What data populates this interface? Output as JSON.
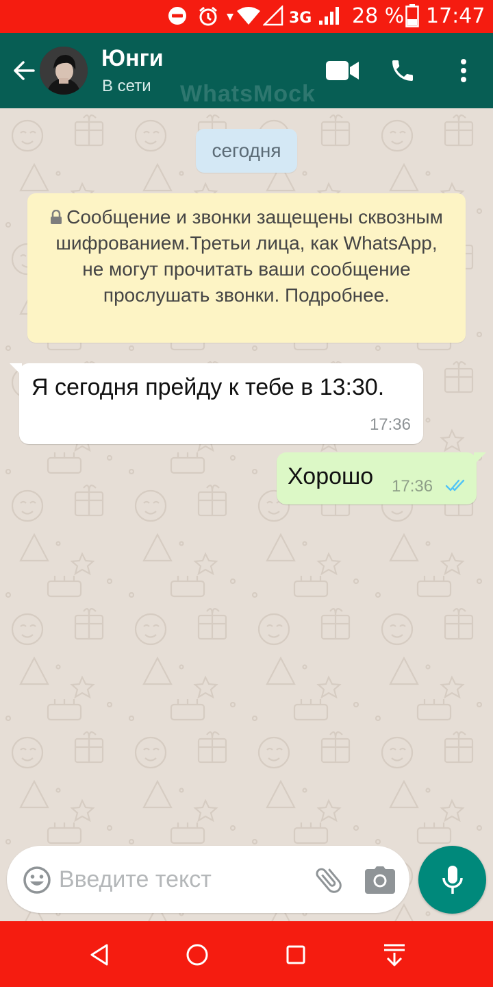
{
  "status_bar": {
    "network": "3G",
    "battery": "28 %",
    "time": "17:47"
  },
  "header": {
    "contact_name": "Юнги",
    "contact_status": "В сети",
    "watermark": "WhatsMock",
    "icons": [
      "back-arrow-icon",
      "video-call-icon",
      "phone-icon",
      "more-vert-icon"
    ]
  },
  "chat": {
    "date_chip": "сегодня",
    "encryption_notice": "Сообщение и звонки защещены сквозным шифрованием.Третьи лица, как WhatsApp, не могут прочитать ваши сообщение прослушать звонки. Подробнее.",
    "messages": [
      {
        "direction": "incoming",
        "text": "Я сегодня прейду к тебе в 13:30.",
        "time": "17:36"
      },
      {
        "direction": "outgoing",
        "text": "Хорошо",
        "time": "17:36",
        "status": "read"
      }
    ]
  },
  "composer": {
    "placeholder": "Введите текст",
    "value": ""
  },
  "colors": {
    "status_bar": "#f51c10",
    "app_bar": "#075e54",
    "mic_button": "#00897b",
    "outgoing_bubble": "#dcf8c6",
    "notice_bubble": "#fdf4c5",
    "date_chip": "#d4e8f5",
    "read_ticks": "#4fc3f7"
  }
}
